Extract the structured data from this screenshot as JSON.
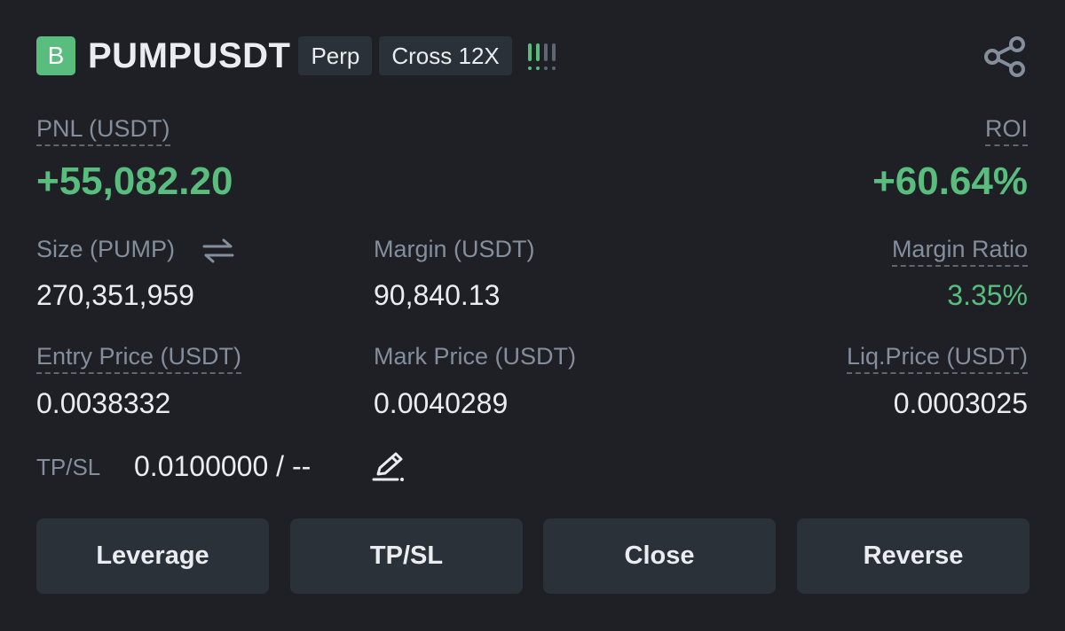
{
  "header": {
    "side_badge": "B",
    "symbol": "PUMPUSDT",
    "tags": [
      "Perp",
      "Cross 12X"
    ],
    "risk_indicator_icon": "signal-bars-icon",
    "share_icon": "share-icon"
  },
  "pnl": {
    "label": "PNL (USDT)",
    "value": "+55,082.20"
  },
  "roi": {
    "label": "ROI",
    "value": "+60.64%"
  },
  "size": {
    "label": "Size (PUMP)",
    "value": "270,351,959",
    "icon": "swap-arrows-icon"
  },
  "margin": {
    "label": "Margin (USDT)",
    "value": "90,840.13"
  },
  "margin_ratio": {
    "label": "Margin Ratio",
    "value": "3.35%"
  },
  "entry_price": {
    "label": "Entry Price (USDT)",
    "value": "0.0038332"
  },
  "mark_price": {
    "label": "Mark Price (USDT)",
    "value": "0.0040289"
  },
  "liq_price": {
    "label": "Liq.Price (USDT)",
    "value": "0.0003025"
  },
  "tpsl": {
    "label": "TP/SL",
    "value": "0.0100000 / --",
    "icon": "edit-icon"
  },
  "buttons": {
    "leverage": "Leverage",
    "tpsl": "TP/SL",
    "close": "Close",
    "reverse": "Reverse"
  },
  "colors": {
    "green": "#58bd7d",
    "background": "#1e2026",
    "button": "#2b3139",
    "label": "#848e9c"
  }
}
